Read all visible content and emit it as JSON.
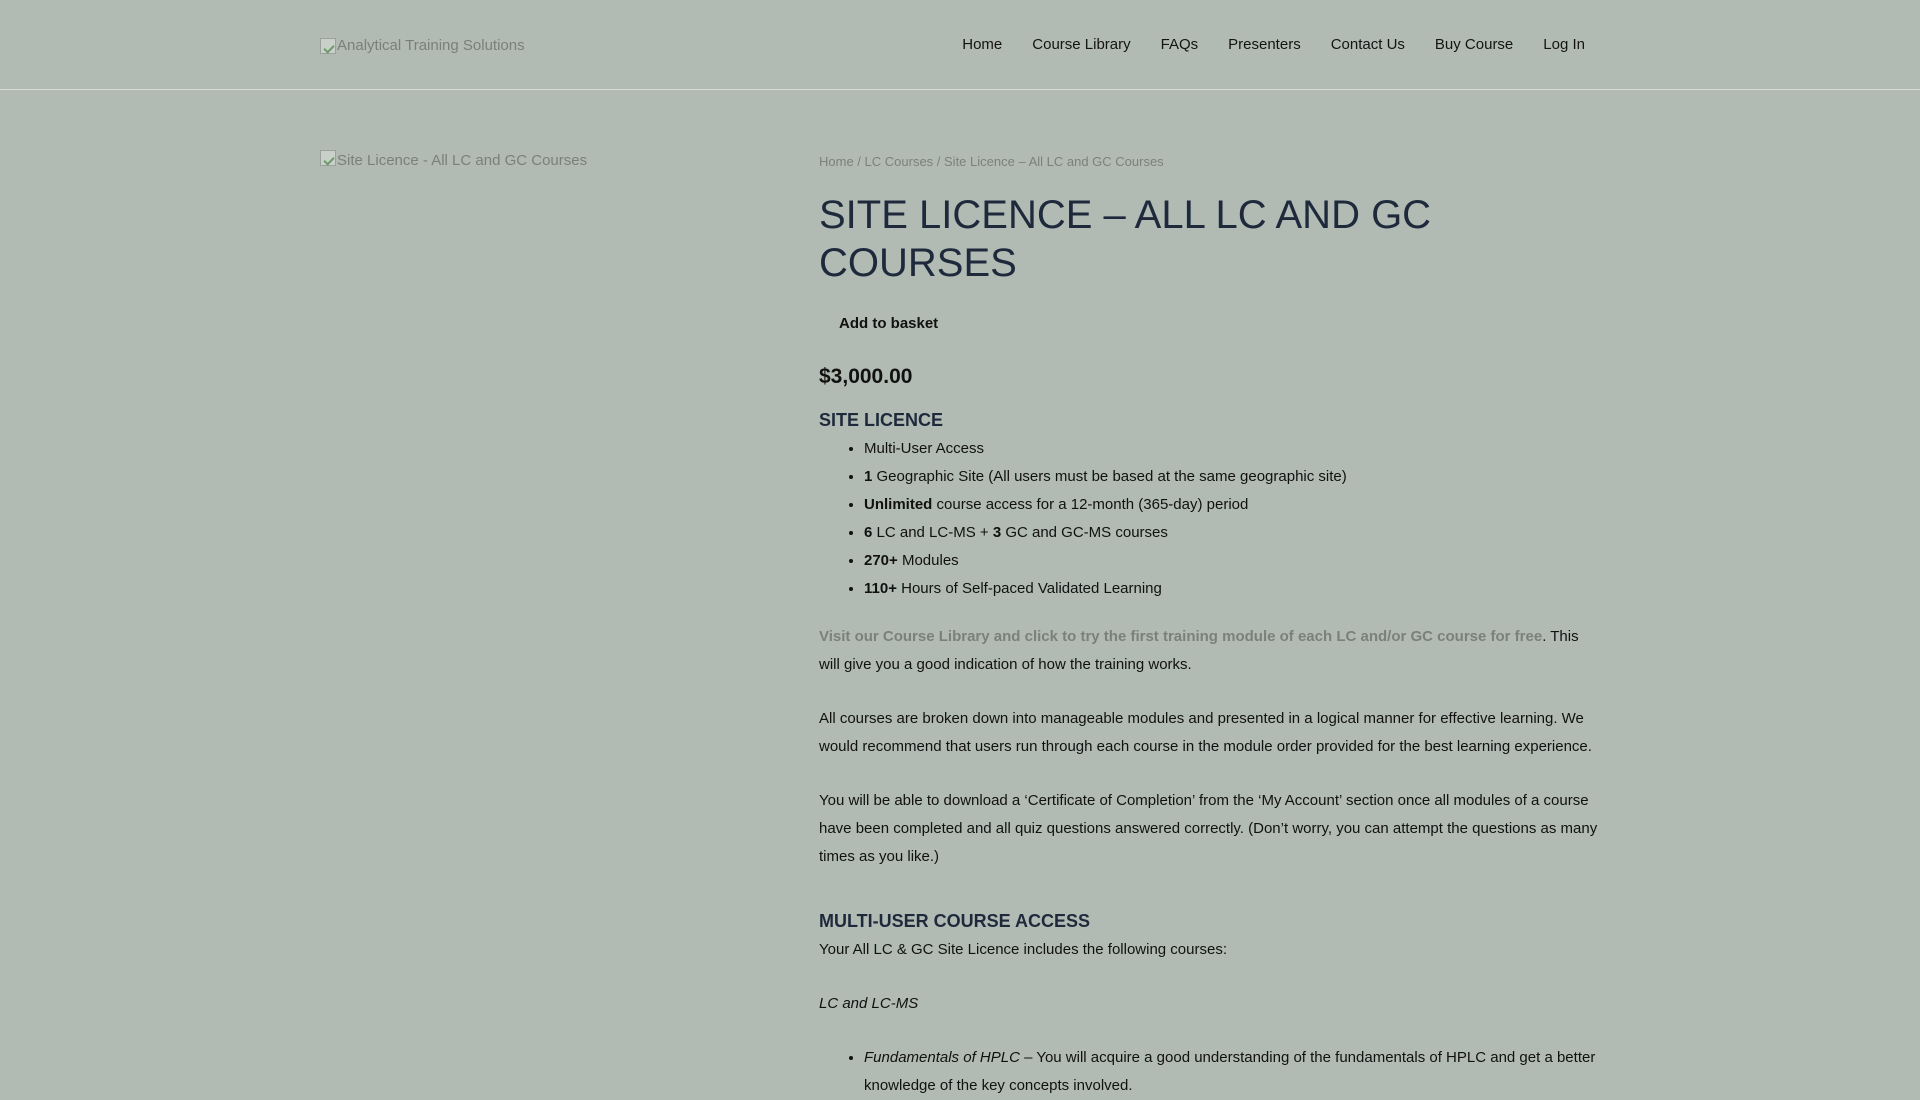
{
  "header": {
    "logo_alt": "Analytical Training Solutions",
    "nav": [
      {
        "label": "Home"
      },
      {
        "label": "Course Library"
      },
      {
        "label": "FAQs"
      },
      {
        "label": "Presenters"
      },
      {
        "label": "Contact Us"
      },
      {
        "label": "Buy Course"
      },
      {
        "label": "Log In"
      }
    ]
  },
  "product_image_alt": "Site Licence - All LC and GC Courses",
  "breadcrumb": {
    "home": "Home",
    "sep": " / ",
    "category": "LC Courses",
    "current": "Site Licence – All LC and GC Courses"
  },
  "product": {
    "title": "Site Licence – All LC and GC Courses",
    "add_to_basket": "Add to basket",
    "price": "$3,000.00"
  },
  "licence": {
    "heading": "SITE LICENCE",
    "features": [
      {
        "bold": "",
        "text": "Multi-User Access"
      },
      {
        "bold": "1",
        "text": " Geographic Site (All users must be based at the same geographic site)"
      },
      {
        "bold": "Unlimited",
        "text": " course access for a 12-month (365-day) period"
      },
      {
        "bold": "6",
        "text": " LC and LC-MS + ",
        "bold2": "3",
        "text2": " GC and GC-MS courses"
      },
      {
        "bold": "270+",
        "text": " Modules"
      },
      {
        "bold": "110+",
        "text": " Hours of Self-paced Validated Learning"
      }
    ]
  },
  "description": {
    "visit_link": "Visit our Course Library and click to try the first training module of each LC and/or GC course for free",
    "visit_rest": ". This will give you a good indication of how the training works.",
    "para2": "All courses are broken down into manageable modules and presented in a logical manner for effective learning. We would recommend that users run through each course in the module order provided for the best learning experience.",
    "para3": "You will be able to download a ‘Certificate of Completion’ from the ‘My Account’ section once all modules of a course have been completed and all quiz questions answered correctly. (Don’t worry, you can attempt the questions as many times as you like.)"
  },
  "multi_user": {
    "heading": "MULTI-USER COURSE ACCESS",
    "intro": "Your All LC & GC Site Licence includes the following courses:",
    "subhead": "LC and LC-MS",
    "courses": [
      {
        "name": "Fundamentals of HPLC",
        "desc": " – You will acquire a good understanding of the fundamentals of HPLC and get a better knowledge of the key concepts involved."
      }
    ]
  }
}
